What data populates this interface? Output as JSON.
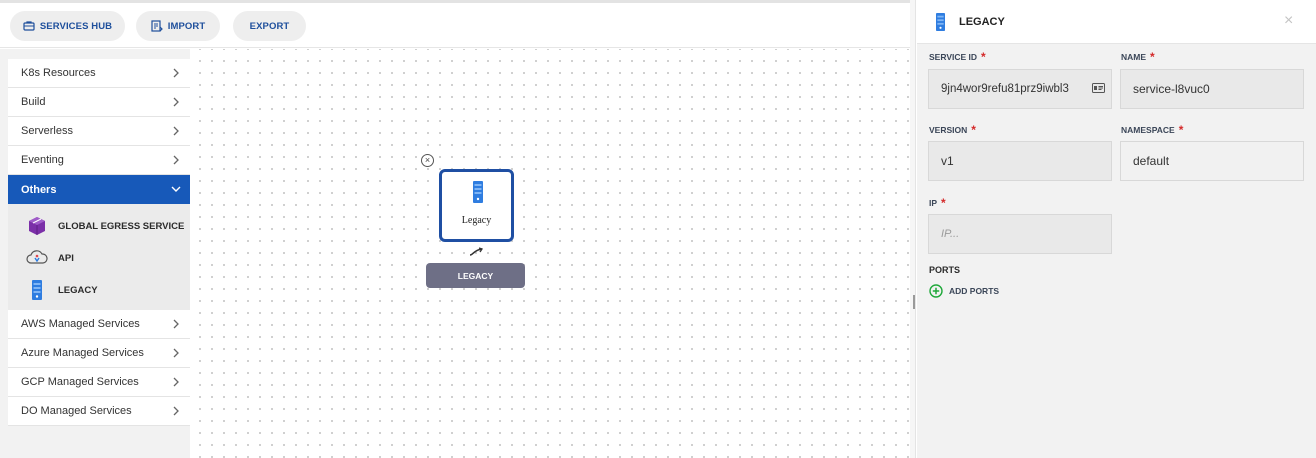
{
  "toolbar": {
    "services_hub_label": "SERVICES HUB",
    "import_label": "IMPORT",
    "export_label": "EXPORT"
  },
  "sidebar": {
    "categories_top": [
      {
        "label": "K8s Resources"
      },
      {
        "label": "Build"
      },
      {
        "label": "Serverless"
      },
      {
        "label": "Eventing"
      }
    ],
    "active_category": {
      "label": "Others"
    },
    "sub_items": [
      {
        "label": "GLOBAL EGRESS SERVICE",
        "icon": "cube-icon"
      },
      {
        "label": "API",
        "icon": "cloud-api-icon"
      },
      {
        "label": "LEGACY",
        "icon": "server-icon"
      }
    ],
    "categories_bottom": [
      {
        "label": "AWS Managed Services"
      },
      {
        "label": "Azure Managed Services"
      },
      {
        "label": "GCP Managed Services"
      },
      {
        "label": "DO Managed Services"
      }
    ]
  },
  "canvas": {
    "node": {
      "label": "Legacy",
      "badge": "LEGACY",
      "icon": "server-icon",
      "close_symbol": "×"
    }
  },
  "panel": {
    "title": "LEGACY",
    "close_symbol": "×",
    "required_mark": "*",
    "fields": {
      "service_id": {
        "label": "SERVICE ID",
        "value": "9jn4wor9refu81prz9iwbl3"
      },
      "name": {
        "label": "NAME",
        "value": "service-l8vuc0"
      },
      "version": {
        "label": "VERSION",
        "value": "v1"
      },
      "namespace": {
        "label": "NAMESPACE",
        "value": "default"
      },
      "ip": {
        "label": "IP",
        "placeholder": "IP..."
      }
    },
    "ports_label": "PORTS",
    "add_ports_label": "ADD PORTS"
  },
  "colors": {
    "accent_blue": "#1759b9",
    "node_border": "#1f4fa3",
    "badge_bg": "#6e6f86",
    "required_red": "#d42a2a",
    "add_green": "#1fa83a",
    "cube_purple": "#7b2fa8"
  }
}
